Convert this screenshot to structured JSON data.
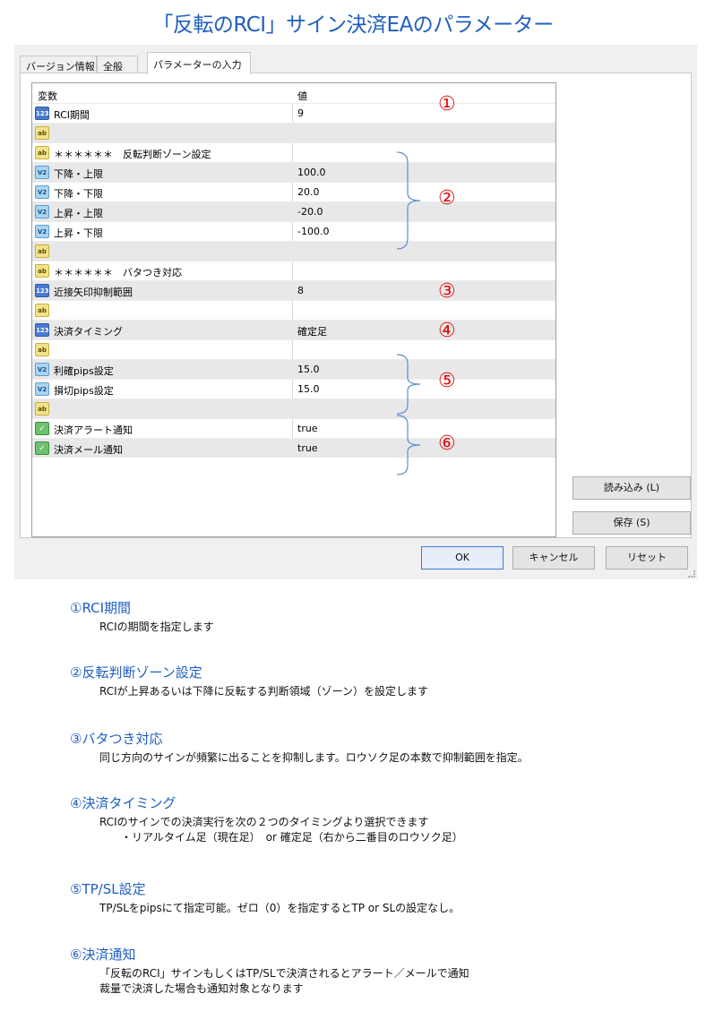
{
  "page_title": "「反転のRCI」サイン決済EAのパラメーター",
  "tabs": [
    {
      "label": "バージョン情報"
    },
    {
      "label": "全般"
    },
    {
      "label": "パラメーターの入力"
    }
  ],
  "grid": {
    "header_variable": "変数",
    "header_value": "値",
    "rows": [
      {
        "icon": "123",
        "variable": "RCI期間",
        "value": "9"
      },
      {
        "icon": "ab",
        "variable": "",
        "value": ""
      },
      {
        "icon": "ab",
        "variable": "＊＊＊＊＊＊　反転判断ゾーン設定",
        "value": ""
      },
      {
        "icon": "V2",
        "variable": "下降・上限",
        "value": "100.0"
      },
      {
        "icon": "V2",
        "variable": "下降・下限",
        "value": "20.0"
      },
      {
        "icon": "V2",
        "variable": "上昇・上限",
        "value": "-20.0"
      },
      {
        "icon": "V2",
        "variable": "上昇・下限",
        "value": "-100.0"
      },
      {
        "icon": "ab",
        "variable": "",
        "value": ""
      },
      {
        "icon": "ab",
        "variable": "＊＊＊＊＊＊　バタつき対応",
        "value": ""
      },
      {
        "icon": "123",
        "variable": "近接矢印抑制範囲",
        "value": "8"
      },
      {
        "icon": "ab",
        "variable": "",
        "value": ""
      },
      {
        "icon": "123",
        "variable": "決済タイミング",
        "value": "確定足"
      },
      {
        "icon": "ab",
        "variable": "",
        "value": ""
      },
      {
        "icon": "V2",
        "variable": "利確pips設定",
        "value": "15.0"
      },
      {
        "icon": "V2",
        "variable": "損切pips設定",
        "value": "15.0"
      },
      {
        "icon": "ab",
        "variable": "",
        "value": ""
      },
      {
        "icon": "✓",
        "variable": "決済アラート通知",
        "value": "true"
      },
      {
        "icon": "✓",
        "variable": "決済メール通知",
        "value": "true"
      }
    ]
  },
  "markers": [
    "①",
    "②",
    "③",
    "④",
    "⑤",
    "⑥"
  ],
  "buttons": {
    "load": "読み込み (L)",
    "save": "保存 (S)",
    "ok": "OK",
    "cancel": "キャンセル",
    "reset": "リセット"
  },
  "descriptions": [
    {
      "title": "①RCI期間",
      "lines": [
        "RCIの期間を指定します"
      ]
    },
    {
      "title": "②反転判断ゾーン設定",
      "lines": [
        "RCIが上昇あるいは下降に反転する判断領域（ゾーン）を設定します"
      ]
    },
    {
      "title": "③バタつき対応",
      "lines": [
        "同じ方向のサインが頻繁に出ることを抑制します。ロウソク足の本数で抑制範囲を指定。"
      ]
    },
    {
      "title": "④決済タイミング",
      "lines": [
        "RCIのサインでの決済実行を次の２つのタイミングより選択できます",
        "　　・リアルタイム足（現在足）　or 確定足（右から二番目のロウソク足）"
      ]
    },
    {
      "title": "⑤TP/SL設定",
      "lines": [
        "TP/SLをpipsにて指定可能。ゼロ（0）を指定するとTP or SLの設定なし。"
      ]
    },
    {
      "title": "⑥決済通知",
      "lines": [
        "「反転のRCI」サインもしくはTP/SLで決済されるとアラート／メールで通知",
        "裁量で決済した場合も通知対象となります"
      ]
    }
  ],
  "colors": {
    "title_blue": "#1f5fbf",
    "marker_red": "#e01010",
    "brace_blue": "#5a8fd0"
  }
}
